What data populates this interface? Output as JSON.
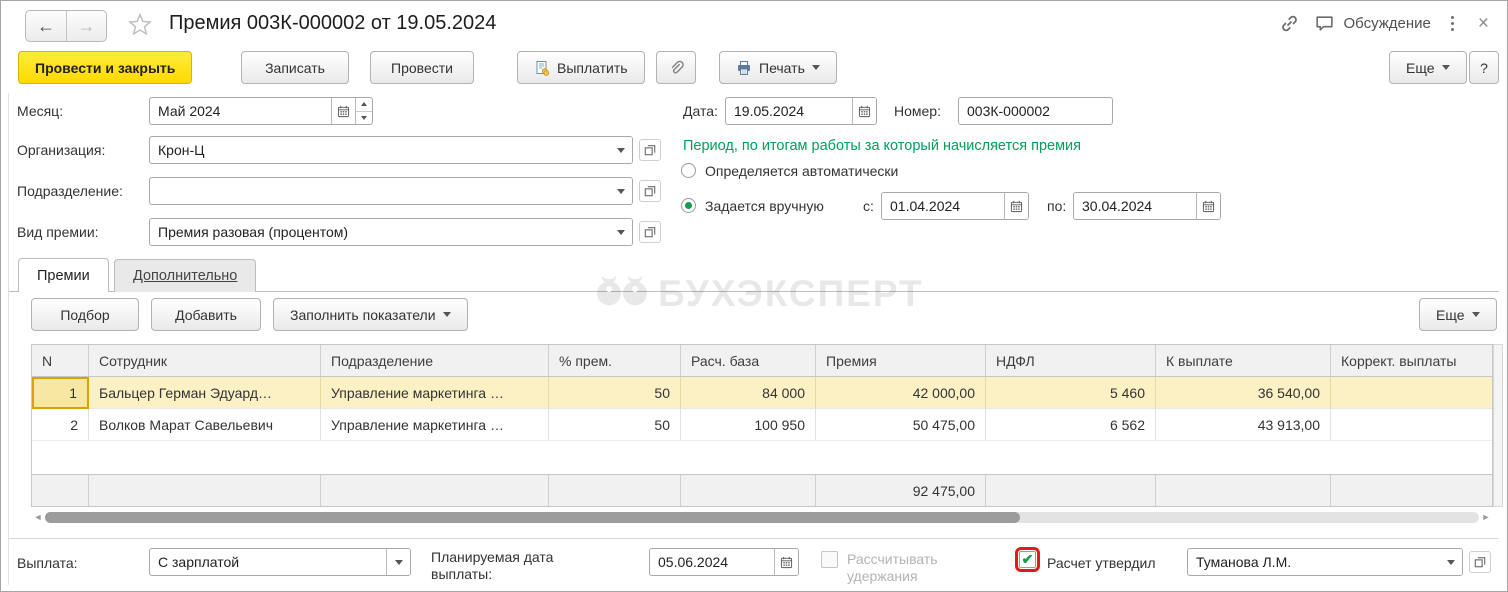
{
  "window": {
    "title": "Премия 003К-000002 от 19.05.2024",
    "discussion_label": "Обсуждение",
    "back": "←",
    "forward": "→",
    "close": "×"
  },
  "toolbar": {
    "post_and_close": "Провести и закрыть",
    "save": "Записать",
    "post": "Провести",
    "pay": "Выплатить",
    "print": "Печать",
    "more": "Еще",
    "help": "?"
  },
  "form": {
    "month": {
      "label": "Месяц:",
      "value": "Май 2024"
    },
    "organization": {
      "label": "Организация:",
      "value": "Крон-Ц"
    },
    "department": {
      "label": "Подразделение:",
      "value": ""
    },
    "bonus_type": {
      "label": "Вид премии:",
      "value": "Премия разовая (процентом)"
    },
    "date": {
      "label": "Дата:",
      "value": "19.05.2024"
    },
    "number": {
      "label": "Номер:",
      "value": "003К-000002"
    },
    "period": {
      "heading": "Период, по итогам работы за который начисляется премия",
      "auto_option": "Определяется автоматически",
      "manual_option": "Задается вручную",
      "from_label": "с:",
      "from_value": "01.04.2024",
      "to_label": "по:",
      "to_value": "30.04.2024"
    }
  },
  "tabs": {
    "bonuses": "Премии",
    "additional": "Дополнительно"
  },
  "table_toolbar": {
    "pick": "Подбор",
    "add": "Добавить",
    "fill_indicators": "Заполнить показатели",
    "more": "Еще"
  },
  "watermark": "БУХЭКСПЕРТ",
  "table": {
    "columns": [
      "N",
      "Сотрудник",
      "Подразделение",
      "% прем.",
      "Расч. база",
      "Премия",
      "НДФЛ",
      "К выплате",
      "Коррект. выплаты"
    ],
    "rows": [
      {
        "n": "1",
        "employee": "Бальцер Герман Эдуард…",
        "department": "Управление маркетинга …",
        "percent": "50",
        "base": "84 000",
        "bonus": "42 000,00",
        "ndfl": "5 460",
        "to_pay": "36 540,00",
        "correction": ""
      },
      {
        "n": "2",
        "employee": "Волков Марат Савельевич",
        "department": "Управление маркетинга …",
        "percent": "50",
        "base": "100 950",
        "bonus": "50 475,00",
        "ndfl": "6 562",
        "to_pay": "43 913,00",
        "correction": ""
      }
    ],
    "totals": {
      "bonus": "92 475,00"
    }
  },
  "footer": {
    "payment": {
      "label": "Выплата:",
      "value": "С зарплатой"
    },
    "planned_date": {
      "label": "Планируемая дата выплаты:",
      "value": "05.06.2024"
    },
    "calc_deductions_label": "Рассчитывать удержания",
    "approved": {
      "label": "Расчет утвердил",
      "value": "Туманова Л.М.",
      "checked": "✔"
    }
  },
  "colors": {
    "accent_yellow": "#ffdd00",
    "green": "#00a05a",
    "row_selection": "#fcf1c4",
    "cell_border": "#d7a400",
    "red_highlight": "#e01b1b"
  }
}
